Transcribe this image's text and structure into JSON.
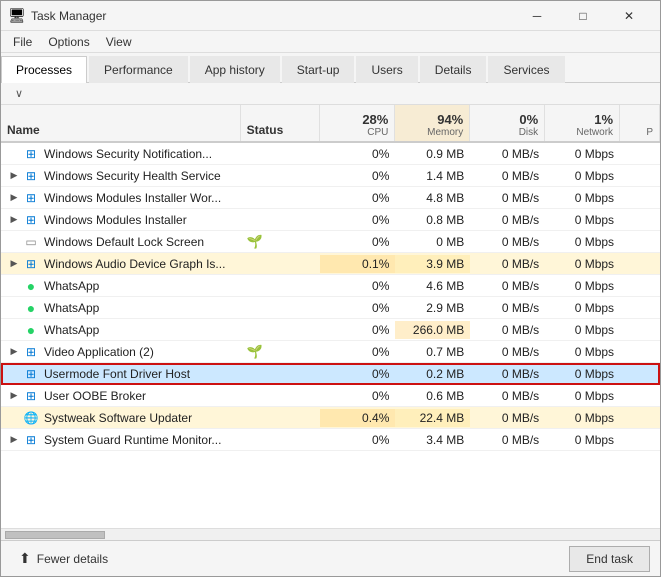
{
  "titleBar": {
    "title": "Task Manager",
    "minimizeLabel": "─",
    "maximizeLabel": "□",
    "closeLabel": "✕"
  },
  "menuBar": {
    "items": [
      "File",
      "Options",
      "View"
    ]
  },
  "tabs": [
    {
      "label": "Processes",
      "active": true
    },
    {
      "label": "Performance"
    },
    {
      "label": "App history"
    },
    {
      "label": "Start-up"
    },
    {
      "label": "Users"
    },
    {
      "label": "Details"
    },
    {
      "label": "Services"
    }
  ],
  "columnSortArrow": "∨",
  "headers": {
    "name": "Name",
    "status": "Status",
    "cpuPct": "28%",
    "cpuLabel": "CPU",
    "memPct": "94%",
    "memLabel": "Memory",
    "diskPct": "0%",
    "diskLabel": "Disk",
    "netPct": "1%",
    "netLabel": "Network",
    "powerLabel": "P"
  },
  "rows": [
    {
      "id": "row-1",
      "expandable": false,
      "icon": "shield",
      "name": "Windows Security Notification...",
      "status": "",
      "cpu": "0%",
      "memory": "0.9 MB",
      "disk": "0 MB/s",
      "network": "0 Mbps",
      "highlighted": false,
      "selected": false,
      "cpuBg": false,
      "memBg": false
    },
    {
      "id": "row-2",
      "expandable": true,
      "icon": "windows",
      "name": "Windows Security Health Service",
      "status": "",
      "cpu": "0%",
      "memory": "1.4 MB",
      "disk": "0 MB/s",
      "network": "0 Mbps",
      "highlighted": false,
      "selected": false,
      "cpuBg": false,
      "memBg": false
    },
    {
      "id": "row-3",
      "expandable": true,
      "icon": "windows",
      "name": "Windows Modules Installer Wor...",
      "status": "",
      "cpu": "0%",
      "memory": "4.8 MB",
      "disk": "0 MB/s",
      "network": "0 Mbps",
      "highlighted": false,
      "selected": false,
      "cpuBg": false,
      "memBg": false
    },
    {
      "id": "row-4",
      "expandable": true,
      "icon": "windows",
      "name": "Windows Modules Installer",
      "status": "",
      "cpu": "0%",
      "memory": "0.8 MB",
      "disk": "0 MB/s",
      "network": "0 Mbps",
      "highlighted": false,
      "selected": false,
      "cpuBg": false,
      "memBg": false
    },
    {
      "id": "row-5",
      "expandable": false,
      "icon": "whitebox",
      "name": "Windows Default Lock Screen",
      "status": "🌱",
      "cpu": "0%",
      "memory": "0 MB",
      "disk": "0 MB/s",
      "network": "0 Mbps",
      "highlighted": false,
      "selected": false,
      "cpuBg": false,
      "memBg": false
    },
    {
      "id": "row-6",
      "expandable": true,
      "icon": "windows",
      "name": "Windows Audio Device Graph Is...",
      "status": "",
      "cpu": "0.1%",
      "memory": "3.9 MB",
      "disk": "0 MB/s",
      "network": "0 Mbps",
      "highlighted": true,
      "selected": false,
      "cpuBg": true,
      "memBg": false
    },
    {
      "id": "row-7",
      "expandable": false,
      "icon": "whatsapp",
      "name": "WhatsApp",
      "status": "",
      "cpu": "0%",
      "memory": "4.6 MB",
      "disk": "0 MB/s",
      "network": "0 Mbps",
      "highlighted": false,
      "selected": false,
      "cpuBg": false,
      "memBg": false
    },
    {
      "id": "row-8",
      "expandable": false,
      "icon": "whatsapp",
      "name": "WhatsApp",
      "status": "",
      "cpu": "0%",
      "memory": "2.9 MB",
      "disk": "0 MB/s",
      "network": "0 Mbps",
      "highlighted": false,
      "selected": false,
      "cpuBg": false,
      "memBg": false
    },
    {
      "id": "row-9",
      "expandable": false,
      "icon": "whatsapp",
      "name": "WhatsApp",
      "status": "",
      "cpu": "0%",
      "memory": "266.0 MB",
      "disk": "0 MB/s",
      "network": "0 Mbps",
      "highlighted": false,
      "selected": false,
      "cpuBg": false,
      "memBg": true
    },
    {
      "id": "row-10",
      "expandable": true,
      "icon": "windows",
      "name": "Video Application (2)",
      "status": "🌱",
      "cpu": "0%",
      "memory": "0.7 MB",
      "disk": "0 MB/s",
      "network": "0 Mbps",
      "highlighted": false,
      "selected": false,
      "cpuBg": false,
      "memBg": false
    },
    {
      "id": "row-11",
      "expandable": false,
      "icon": "windows",
      "name": "Usermode Font Driver Host",
      "status": "",
      "cpu": "0%",
      "memory": "0.2 MB",
      "disk": "0 MB/s",
      "network": "0 Mbps",
      "highlighted": false,
      "selected": true,
      "cpuBg": false,
      "memBg": false
    },
    {
      "id": "row-12",
      "expandable": true,
      "icon": "windows",
      "name": "User OOBE Broker",
      "status": "",
      "cpu": "0%",
      "memory": "0.6 MB",
      "disk": "0 MB/s",
      "network": "0 Mbps",
      "highlighted": false,
      "selected": false,
      "cpuBg": false,
      "memBg": false
    },
    {
      "id": "row-13",
      "expandable": false,
      "icon": "globe",
      "name": "Systweak Software Updater",
      "status": "",
      "cpu": "0.4%",
      "memory": "22.4 MB",
      "disk": "0 MB/s",
      "network": "0 Mbps",
      "highlighted": true,
      "selected": false,
      "cpuBg": true,
      "memBg": false
    },
    {
      "id": "row-14",
      "expandable": true,
      "icon": "windows",
      "name": "System Guard Runtime Monitor...",
      "status": "",
      "cpu": "0%",
      "memory": "3.4 MB",
      "disk": "0 MB/s",
      "network": "0 Mbps",
      "highlighted": false,
      "selected": false,
      "cpuBg": false,
      "memBg": false
    }
  ],
  "bottomBar": {
    "fewerDetails": "Fewer details",
    "endTask": "End task"
  }
}
